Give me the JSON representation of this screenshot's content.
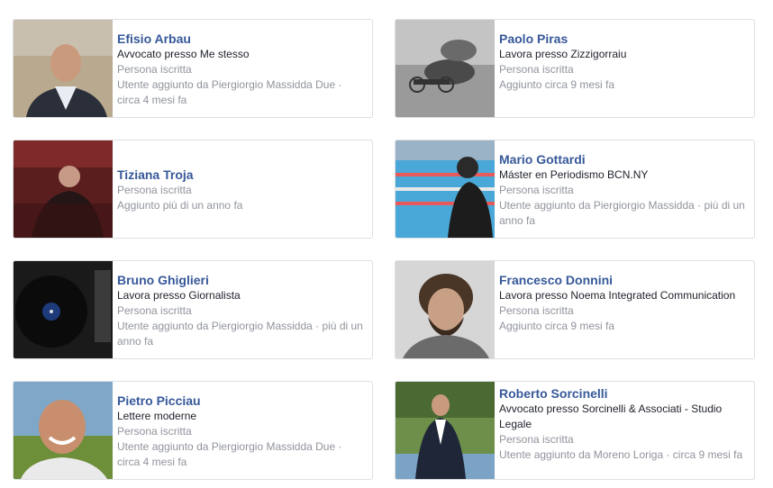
{
  "friends": [
    {
      "name": "Efisio Arbau",
      "job": "Avvocato presso Me stesso",
      "status": "Persona iscritta",
      "added": "Utente aggiunto da Piergiorgio Massidda Due · circa 4 mesi fa",
      "photo_icon": "profile-photo"
    },
    {
      "name": "Paolo Piras",
      "job": "Lavora presso Zizzigorraiu",
      "status": "Persona iscritta",
      "added": "Aggiunto circa 9 mesi fa",
      "photo_icon": "profile-photo"
    },
    {
      "name": "Tiziana Troja",
      "job": "",
      "status": "Persona iscritta",
      "added": "Aggiunto più di un anno fa",
      "photo_icon": "profile-photo"
    },
    {
      "name": "Mario Gottardi",
      "job": "Máster en Periodismo BCN.NY",
      "status": "Persona iscritta",
      "added": "Utente aggiunto da Piergiorgio Massidda · più di un anno fa",
      "photo_icon": "profile-photo"
    },
    {
      "name": "Bruno Ghiglieri",
      "job": "Lavora presso Giornalista",
      "status": "Persona iscritta",
      "added": "Utente aggiunto da Piergiorgio Massidda · più di un anno fa",
      "photo_icon": "profile-photo"
    },
    {
      "name": "Francesco Donnini",
      "job": "Lavora presso Noema Integrated Communication",
      "status": "Persona iscritta",
      "added": "Aggiunto circa 9 mesi fa",
      "photo_icon": "profile-photo"
    },
    {
      "name": "Pietro Picciau",
      "job": "Lettere moderne",
      "status": "Persona iscritta",
      "added": "Utente aggiunto da Piergiorgio Massidda Due · circa 4 mesi fa",
      "photo_icon": "profile-photo"
    },
    {
      "name": "Roberto Sorcinelli",
      "job": "Avvocato presso Sorcinelli & Associati - Studio Legale",
      "status": "Persona iscritta",
      "added": "Utente aggiunto da Moreno Loriga · circa 9 mesi fa",
      "photo_icon": "profile-photo"
    }
  ],
  "colors": {
    "name": "#365899",
    "text": "#1d2129",
    "meta": "#90949c",
    "border": "#dddfe2"
  }
}
